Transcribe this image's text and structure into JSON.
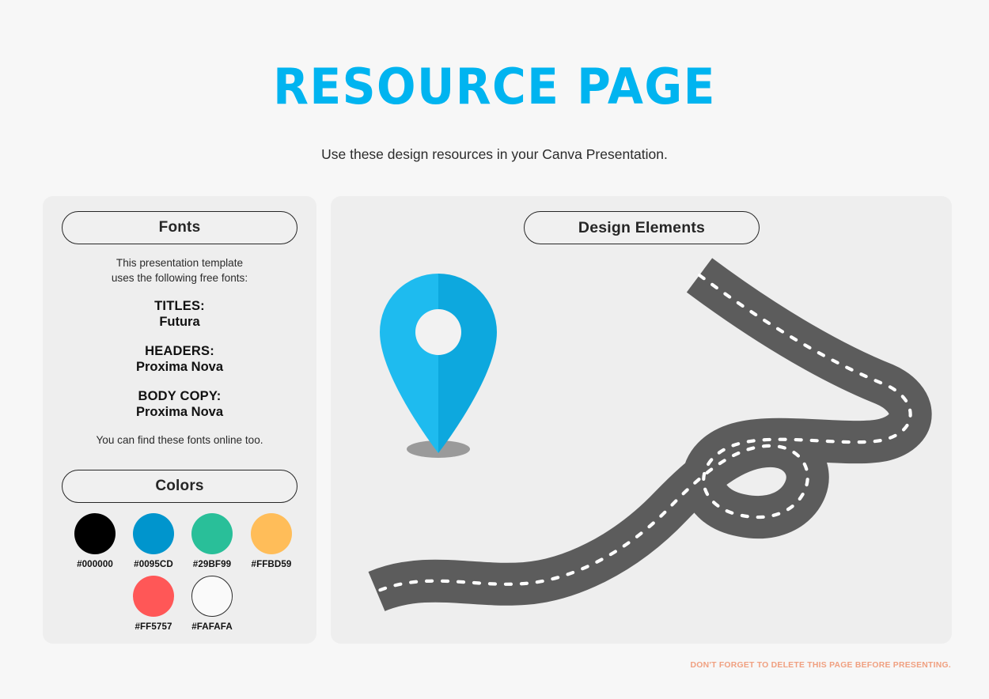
{
  "header": {
    "title": "RESOURCE PAGE",
    "subtitle": "Use these design resources in your Canva Presentation.",
    "title_color": "#00B4F0"
  },
  "fonts_panel": {
    "heading": "Fonts",
    "intro_line_1": "This presentation template",
    "intro_line_2": "uses the following free fonts:",
    "groups": [
      {
        "label": "TITLES:",
        "value": "Futura"
      },
      {
        "label": "HEADERS:",
        "value": "Proxima Nova"
      },
      {
        "label": "BODY COPY:",
        "value": "Proxima Nova"
      }
    ],
    "outro": "You can find these fonts online too."
  },
  "colors_panel": {
    "heading": "Colors",
    "swatches": [
      {
        "hex": "#000000",
        "label": "#000000",
        "outlined": false
      },
      {
        "hex": "#0095CD",
        "label": "#0095CD",
        "outlined": false
      },
      {
        "hex": "#29BF99",
        "label": "#29BF99",
        "outlined": false
      },
      {
        "hex": "#FFBD59",
        "label": "#FFBD59",
        "outlined": false
      },
      {
        "hex": "#FF5757",
        "label": "#FF5757",
        "outlined": false
      },
      {
        "hex": "#FAFAFA",
        "label": "#FAFAFA",
        "outlined": true
      }
    ]
  },
  "design_panel": {
    "heading": "Design Elements",
    "elements": [
      {
        "name": "map-pin",
        "colors": {
          "left": "#1EBBEF",
          "right": "#0EA5DC",
          "hole": "#F4F4F4",
          "shadow": "#9A9A9A"
        }
      },
      {
        "name": "winding-road",
        "colors": {
          "asphalt": "#5C5C5C",
          "center_line": "#FFFFFF"
        }
      }
    ]
  },
  "footer": {
    "note": "DON'T FORGET TO DELETE THIS PAGE BEFORE PRESENTING.",
    "note_color": "#F0A080"
  },
  "page": {
    "background": "#F7F7F7",
    "panel_background": "#EEEEEE"
  }
}
